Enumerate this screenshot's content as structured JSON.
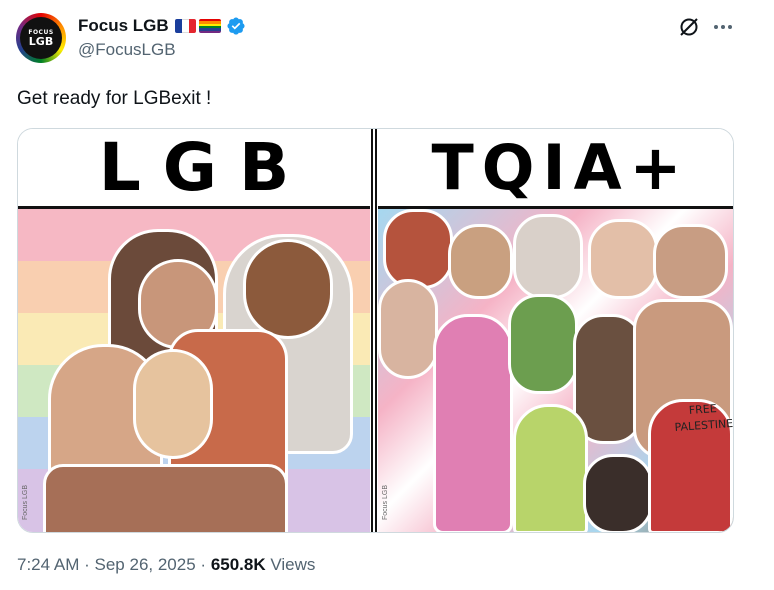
{
  "author": {
    "display_name": "Focus LGB",
    "handle": "@FocusLGB",
    "avatar_text_small": "FOCUS",
    "avatar_text_big": "LGB",
    "verified_color": "#1d9bf0"
  },
  "tweet": {
    "text": "Get ready for LGBexit !",
    "time": "7:24 AM",
    "separator": "·",
    "date": "Sep 26, 2025",
    "views_count": "650.8K",
    "views_label": "Views"
  },
  "media": {
    "left_title": "LGB",
    "right_title": "TQIA+",
    "overlay_text_line1": "FREE",
    "overlay_text_line2": "PALESTINE",
    "watermark_left": "Focus LGB",
    "watermark_right": "Focus LGB"
  },
  "icons": {
    "grok": "grok-icon",
    "more": "more-icon",
    "verified": "verified-badge-icon",
    "flag_france": "flag-france-icon",
    "flag_rainbow": "flag-rainbow-icon"
  },
  "colors": {
    "text_primary": "#0f1419",
    "text_secondary": "#536471",
    "border": "#cfd9de"
  }
}
